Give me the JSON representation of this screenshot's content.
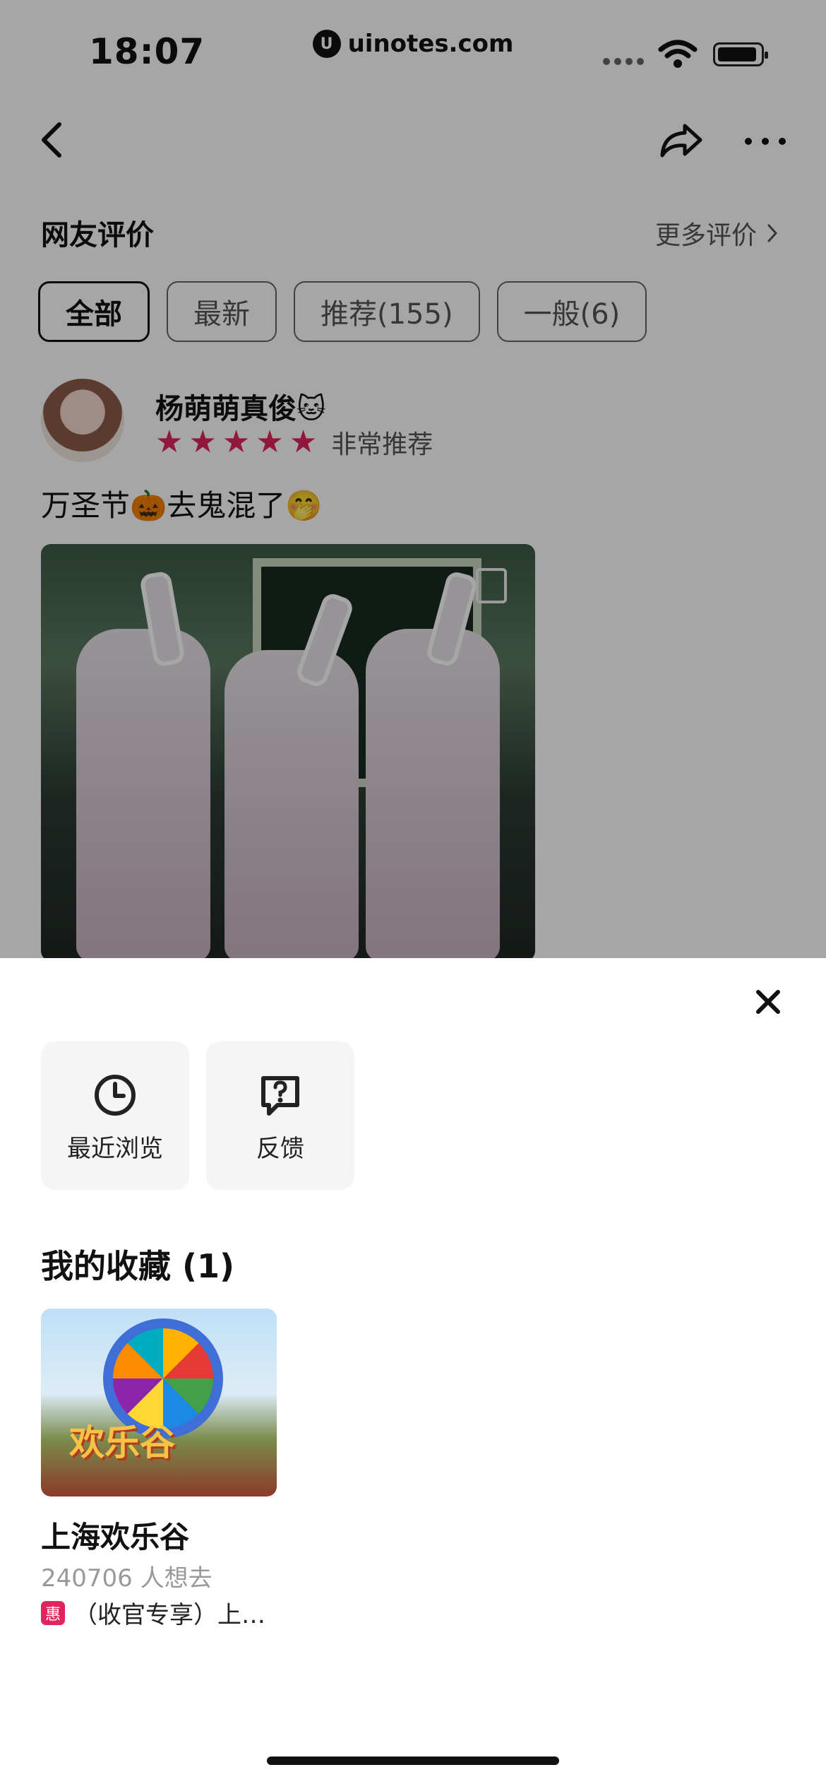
{
  "status": {
    "time": "18:07",
    "site": "uinotes.com",
    "site_logo": "U"
  },
  "reviews": {
    "section_title": "网友评价",
    "more_label": "更多评价",
    "filters": [
      "全部",
      "最新",
      "推荐(155)",
      "一般(6)"
    ],
    "active_filter_index": 0,
    "review": {
      "username": "杨萌萌真俊🐱",
      "rating": 5,
      "rating_max": 5,
      "rating_label": "非常推荐",
      "text": "万圣节🎃去鬼混了🤭"
    }
  },
  "sheet": {
    "actions": [
      {
        "label": "最近浏览",
        "icon": "clock-icon"
      },
      {
        "label": "反馈",
        "icon": "feedback-icon"
      }
    ],
    "favorites_title": "我的收藏 (1)",
    "favorite": {
      "image_sign": "欢乐谷",
      "title": "上海欢乐谷",
      "subtitle": "240706 人想去",
      "promo_badge": "惠",
      "promo_text": "（收官专享）上…"
    }
  },
  "colors": {
    "accent": "#e0245e",
    "overlay": "rgba(0,0,0,0.35)"
  }
}
